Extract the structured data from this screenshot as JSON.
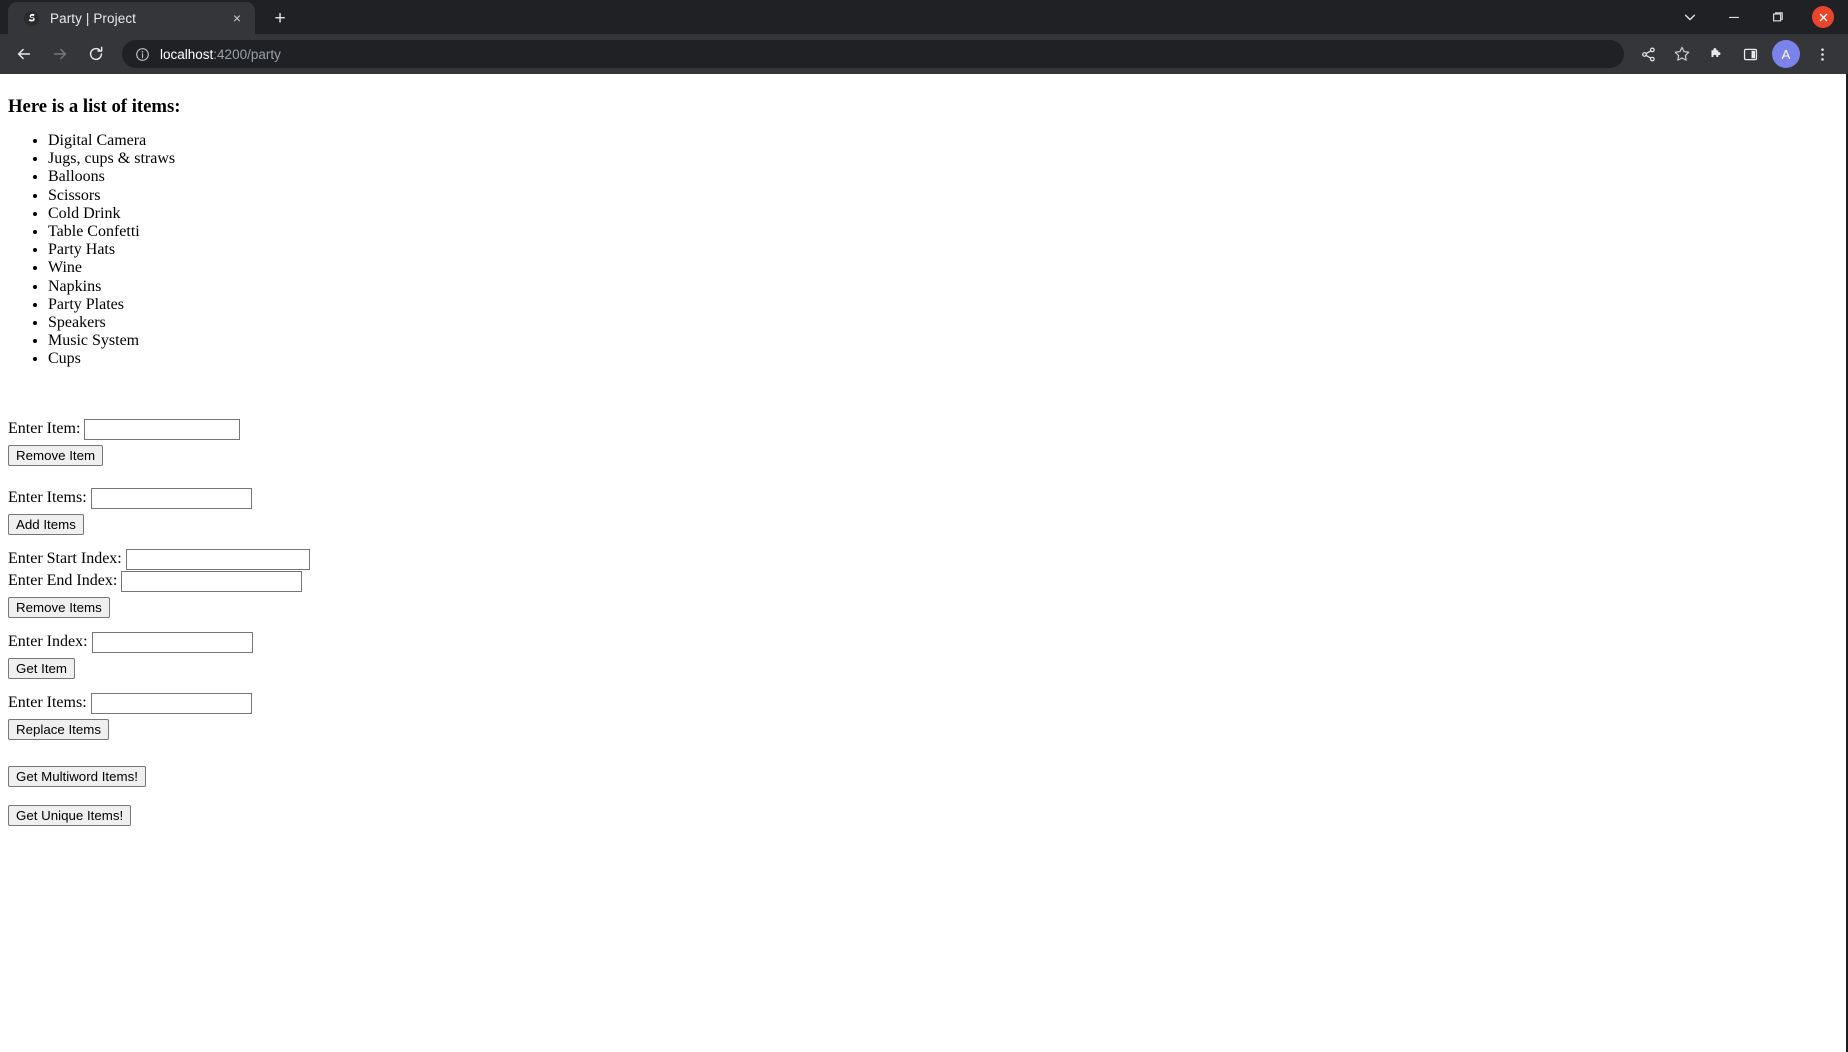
{
  "browser": {
    "tab": {
      "title": "Party | Project",
      "favicon": "globe-icon",
      "close_label": "×"
    },
    "new_tab_label": "+",
    "window_controls": {
      "tab_search": "tab-search-icon",
      "minimize": "minimize-icon",
      "maximize": "maximize-icon",
      "close": "close-icon"
    },
    "nav": {
      "back": "back-arrow-icon",
      "forward": "forward-arrow-icon",
      "reload": "reload-icon"
    },
    "omnibox": {
      "info_icon": "info-icon",
      "host": "localhost",
      "path": ":4200/party",
      "full_url": "localhost:4200/party"
    },
    "actions": {
      "share": "share-icon",
      "bookmark": "star-icon",
      "extensions": "puzzle-piece-icon",
      "side_panel": "side-panel-icon",
      "profile_initial": "A",
      "menu": "three-dot-menu-icon"
    },
    "colors": {
      "tabstrip_bg": "#202124",
      "active_tab_bg": "#35363a",
      "toolbar_bg": "#35363a",
      "omnibox_bg": "#202124",
      "close_btn": "#e8452c",
      "avatar": "#7b83eb",
      "page_bg": "#ffffff"
    }
  },
  "page": {
    "heading": "Here is a list of items:",
    "items": [
      "Digital Camera",
      "Jugs, cups & straws",
      "Balloons",
      "Scissors",
      "Cold Drink",
      "Table Confetti",
      "Party Hats",
      "Wine",
      "Napkins",
      "Party Plates",
      "Speakers",
      "Music System",
      "Cups"
    ],
    "forms": {
      "remove_item": {
        "label": "Enter Item:",
        "value": "",
        "button": "Remove Item"
      },
      "add_items": {
        "label": "Enter Items:",
        "value": "",
        "button": "Add Items"
      },
      "remove_range": {
        "start_label": "Enter Start Index:",
        "start_value": "",
        "end_label": "Enter End Index:",
        "end_value": "",
        "button": "Remove Items"
      },
      "get_item": {
        "label": "Enter Index:",
        "value": "",
        "button": "Get Item"
      },
      "replace_items": {
        "label": "Enter Items:",
        "value": "",
        "button": "Replace Items"
      },
      "multiword": {
        "button": "Get Multiword Items!"
      },
      "unique": {
        "button": "Get Unique Items!"
      }
    }
  }
}
